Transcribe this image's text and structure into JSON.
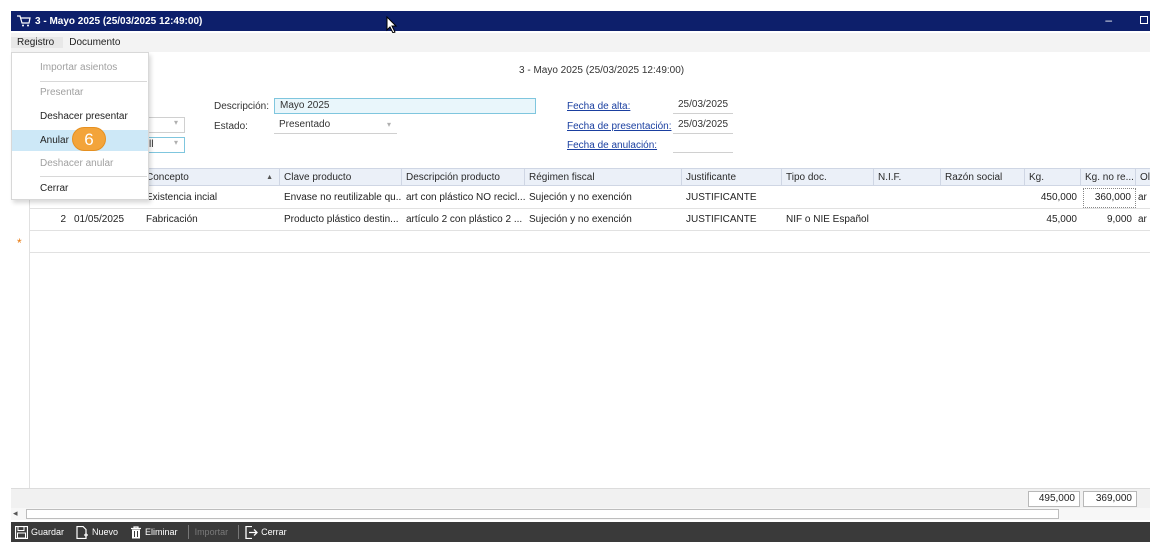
{
  "window": {
    "title": "3 - Mayo 2025 (25/03/2025 12:49:00)",
    "minimize_glyph": "–",
    "icon": "shopping-cart-icon"
  },
  "menubar": {
    "items": [
      {
        "label": "Registro"
      },
      {
        "label": "Documento"
      }
    ]
  },
  "dropdown": {
    "items": [
      {
        "label": "Importar asientos",
        "disabled": true
      },
      {
        "label": "Presentar",
        "disabled": true
      },
      {
        "label": "Deshacer presentar",
        "disabled": false
      },
      {
        "label": "Anular",
        "disabled": false,
        "hover": true
      },
      {
        "label": "Deshacer anular",
        "disabled": true
      },
      {
        "label": "Cerrar",
        "disabled": false
      }
    ],
    "step_badge": "6"
  },
  "form": {
    "title": "3 - Mayo 2025 (25/03/2025 12:49:00)",
    "descripcion_label": "Descripción:",
    "descripcion_value": "Mayo 2025",
    "estado_label": "Estado:",
    "estado_value": "Presentado",
    "partial_field_value": "ll",
    "fecha_alta_label": "Fecha de alta:",
    "fecha_alta_value": "25/03/2025",
    "fecha_presentacion_label": "Fecha de presentación:",
    "fecha_presentacion_value": "25/03/2025",
    "fecha_anulacion_label": "Fecha de anulación:",
    "fecha_anulacion_value": ""
  },
  "grid": {
    "columns": [
      "Concepto",
      "Clave producto",
      "Descripción producto",
      "Régimen fiscal",
      "Justificante",
      "Tipo doc.",
      "N.I.F.",
      "Razón social",
      "Kg.",
      "Kg. no re...",
      "Ol"
    ],
    "sort_glyph": "▲",
    "rows": [
      {
        "num": "",
        "fecha": "",
        "concepto": "Existencia incial",
        "clave": "Envase no reutilizable qu...",
        "descripcion": "art con plástico NO recicl...",
        "regimen": "Sujeción y no exención",
        "justificante": "JUSTIFICANTE",
        "tipo_doc": "",
        "nif": "",
        "razon": "",
        "kg": "450,000",
        "kg_no_re": "360,000",
        "ol": "ar"
      },
      {
        "num": "2",
        "fecha": "01/05/2025",
        "concepto": "Fabricación",
        "clave": "Producto plástico destin...",
        "descripcion": "artículo 2 con plástico 2 ...",
        "regimen": "Sujeción y no exención",
        "justificante": "JUSTIFICANTE",
        "tipo_doc": "NIF o NIE Español",
        "nif": "",
        "razon": "",
        "kg": "45,000",
        "kg_no_re": "9,000",
        "ol": "ar"
      }
    ],
    "new_row_marker": "*",
    "totals": {
      "kg": "495,000",
      "kg_no_re": "369,000"
    }
  },
  "toolbar": {
    "items": [
      {
        "label": "Guardar",
        "icon": "save-icon",
        "disabled": false
      },
      {
        "label": "Nuevo",
        "icon": "new-doc-icon",
        "disabled": false
      },
      {
        "label": "Eliminar",
        "icon": "trash-icon",
        "disabled": false
      },
      {
        "label": "Importar",
        "icon": "",
        "disabled": true
      },
      {
        "label": "Cerrar",
        "icon": "exit-icon",
        "disabled": false
      }
    ]
  },
  "colors": {
    "titlebar": "#0d1f6b",
    "badge": "#f3a43a",
    "hover": "#cde8f7",
    "link": "#1a3fa0",
    "toolbar": "#3a3a3a"
  }
}
